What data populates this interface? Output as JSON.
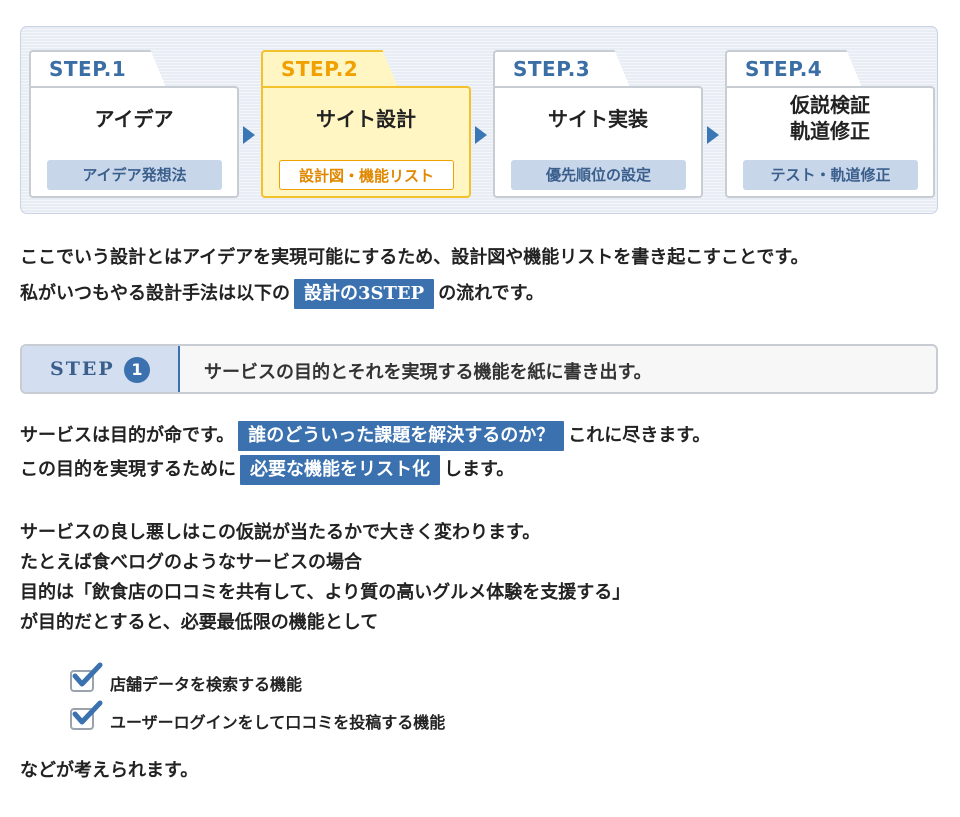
{
  "steps": [
    {
      "label": "STEP.1",
      "title": "アイデア",
      "pill": "アイデア発想法",
      "active": false
    },
    {
      "label": "STEP.2",
      "title": "サイト設計",
      "pill": "設計図・機能リスト",
      "active": true
    },
    {
      "label": "STEP.3",
      "title": "サイト実装",
      "pill": "優先順位の設定",
      "active": false
    },
    {
      "label": "STEP.4",
      "title_line1": "仮説検証",
      "title_line2": "軌道修正",
      "pill": "テスト・軌道修正",
      "active": false
    }
  ],
  "intro": {
    "line1": "ここでいう設計とはアイデアを実現可能にするため、設計図や機能リストを書き起こすことです。",
    "line2_before": "私がいつもやる設計手法は以下の",
    "line2_highlight": "設計の3STEP",
    "line2_after": "の流れです。"
  },
  "step_header": {
    "label": "STEP",
    "number": "1",
    "description": "サービスの目的とそれを実現する機能を紙に書き出す。"
  },
  "purpose": {
    "line1_before": "サービスは目的が命です。",
    "line1_highlight": "誰のどういった課題を解決するのか？",
    "line1_after": "これに尽きます。",
    "line2_before": "この目的を実現するために",
    "line2_highlight": "必要な機能をリスト化",
    "line2_after": "します。"
  },
  "example": {
    "line1": "サービスの良し悪しはこの仮説が当たるかで大きく変わります。",
    "line2": "たとえば食べログのようなサービスの場合",
    "line3": "目的は「飲食店の口コミを共有して、より質の高いグルメ体験を支援する」",
    "line4": "が目的だとすると、必要最低限の機能として"
  },
  "checklist": [
    "店舗データを検索する機能",
    "ユーザーログインをして口コミを投稿する機能"
  ],
  "closing": "などが考えられます。",
  "colors": {
    "accent_blue": "#3a71ae",
    "active_yellow": "#fff6c4",
    "active_orange": "#f0a000"
  }
}
